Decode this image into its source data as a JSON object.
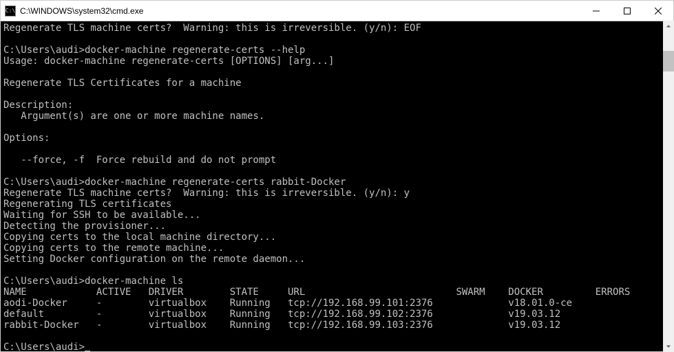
{
  "window": {
    "title": "C:\\WINDOWS\\system32\\cmd.exe",
    "icon_label": "C:\\"
  },
  "terminal": {
    "lines": [
      "Regenerate TLS machine certs?  Warning: this is irreversible. (y/n): EOF",
      "",
      "C:\\Users\\audi>docker-machine regenerate-certs --help",
      "Usage: docker-machine regenerate-certs [OPTIONS] [arg...]",
      "",
      "Regenerate TLS Certificates for a machine",
      "",
      "Description:",
      "   Argument(s) are one or more machine names.",
      "",
      "Options:",
      "",
      "   --force, -f  Force rebuild and do not prompt",
      "",
      "C:\\Users\\audi>docker-machine regenerate-certs rabbit-Docker",
      "Regenerate TLS machine certs?  Warning: this is irreversible. (y/n): y",
      "Regenerating TLS certificates",
      "Waiting for SSH to be available...",
      "Detecting the provisioner...",
      "Copying certs to the local machine directory...",
      "Copying certs to the remote machine...",
      "Setting Docker configuration on the remote daemon...",
      "",
      "C:\\Users\\audi>docker-machine ls"
    ],
    "table": {
      "headers": [
        "NAME",
        "ACTIVE",
        "DRIVER",
        "STATE",
        "URL",
        "SWARM",
        "DOCKER",
        "ERRORS"
      ],
      "rows": [
        {
          "name": "aodi-Docker",
          "active": "-",
          "driver": "virtualbox",
          "state": "Running",
          "url": "tcp://192.168.99.101:2376",
          "swarm": "",
          "docker": "v18.01.0-ce",
          "errors": ""
        },
        {
          "name": "default",
          "active": "-",
          "driver": "virtualbox",
          "state": "Running",
          "url": "tcp://192.168.99.102:2376",
          "swarm": "",
          "docker": "v19.03.12",
          "errors": ""
        },
        {
          "name": "rabbit-Docker",
          "active": "-",
          "driver": "virtualbox",
          "state": "Running",
          "url": "tcp://192.168.99.103:2376",
          "swarm": "",
          "docker": "v19.03.12",
          "errors": ""
        }
      ]
    },
    "prompt": "C:\\Users\\audi>"
  }
}
